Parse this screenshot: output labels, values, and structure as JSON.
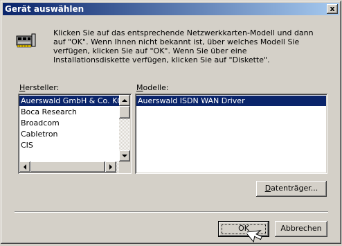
{
  "window": {
    "title": "Gerät auswählen",
    "close_glyph": "x"
  },
  "instructions": "Klicken Sie auf das entsprechende Netzwerkkarten-Modell und dann auf \"OK\". Wenn Ihnen nicht bekannt ist, über welches Modell Sie verfügen, klicken Sie auf \"OK\".  Wenn Sie über eine Installationsdiskette verfügen, klicken Sie auf \"Diskette\".",
  "icon": "network-card-icon",
  "manufacturer": {
    "label_accel": "H",
    "label_rest": "ersteller:",
    "items": [
      "Auerswald GmbH & Co. KG",
      "Boca Research",
      "Broadcom",
      "Cabletron",
      "CIS"
    ],
    "selected_index": 0
  },
  "models": {
    "label_accel": "M",
    "label_rest": "odelle:",
    "items": [
      "Auerswald ISDN WAN Driver"
    ],
    "selected_index": 0
  },
  "buttons": {
    "disk_accel": "D",
    "disk_rest": "atenträger...",
    "ok": "OK",
    "cancel": "Abbrechen"
  },
  "colors": {
    "selection": "#0a246a",
    "face": "#d4d0c8"
  }
}
